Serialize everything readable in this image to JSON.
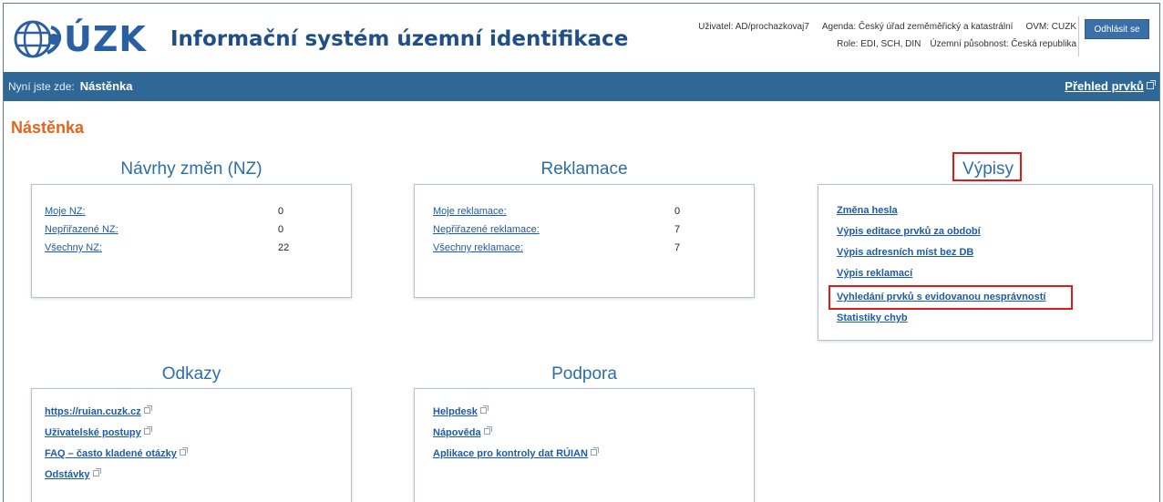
{
  "header": {
    "logo_text": "ÚZK",
    "app_title": "Informační systém územní identifikace",
    "user": "Uživatel: AD/prochazkovaj7",
    "agenda": "Agenda: Český úřad zeměměřický a katastrální",
    "ovm": "OVM: CUZK",
    "role": "Role: EDI, SCH, DIN",
    "territory": "Územní působnost: Česká republika",
    "logout_label": "Odhlásit se"
  },
  "nav": {
    "here_label": "Nyní jste zde:",
    "current": "Nástěnka",
    "overview_link": "Přehled prvků"
  },
  "page_title": "Nástěnka",
  "sections": {
    "nz": {
      "title": "Návrhy změn (NZ)",
      "rows": [
        {
          "label": "Moje NZ:",
          "value": "0"
        },
        {
          "label": "Nepřiřazené NZ:",
          "value": "0"
        },
        {
          "label": "Všechny NZ:",
          "value": "22"
        }
      ]
    },
    "reklamace": {
      "title": "Reklamace",
      "rows": [
        {
          "label": "Moje reklamace:",
          "value": "0"
        },
        {
          "label": "Nepřiřazené reklamace:",
          "value": "7"
        },
        {
          "label": "Všechny reklamace:",
          "value": "7"
        }
      ]
    },
    "vypisy": {
      "title": "Výpisy",
      "links": [
        "Změna hesla",
        "Výpis editace prvků za období",
        "Výpis adresních míst bez DB",
        "Výpis reklamací",
        "Vyhledání prvků s evidovanou nesprávností",
        "Statistiky chyb"
      ]
    },
    "odkazy": {
      "title": "Odkazy",
      "links": [
        "https://ruian.cuzk.cz",
        "Uživatelské postupy",
        "FAQ – často kladené otázky",
        "Odstávky"
      ]
    },
    "podpora": {
      "title": "Podpora",
      "links": [
        "Helpdesk",
        "Nápověda",
        "Aplikace pro kontroly dat RÚIAN"
      ]
    }
  },
  "colors": {
    "brand": "#2a5fa4",
    "navbar": "#2f6896",
    "accent_title": "#e8631a",
    "link": "#1c5ba8",
    "highlight": "#e01a1a"
  }
}
